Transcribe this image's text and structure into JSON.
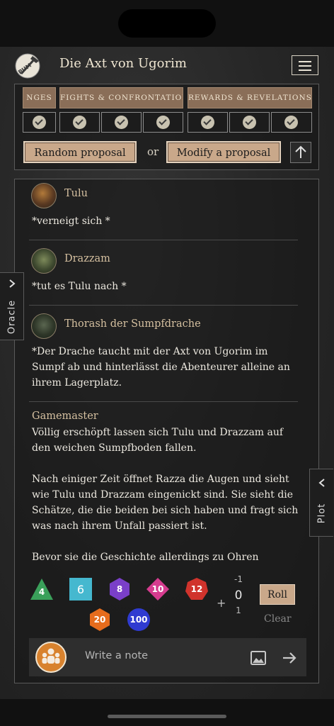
{
  "header": {
    "title": "Die Axt von Ugorim",
    "logo_text": "PUM"
  },
  "oracle": {
    "categories": [
      "NGES",
      "FIGHTS & CONFRONTATION",
      "REWARDS & REVELATIONS"
    ],
    "random_label": "Random proposal",
    "or_label": "or",
    "modify_label": "Modify a proposal"
  },
  "messages": [
    {
      "name": "Tulu",
      "text": "*verneigt sich *"
    },
    {
      "name": "Drazzam",
      "text": "*tut es Tulu nach *"
    },
    {
      "name": "Thorash der Sumpfdrache",
      "text": "*Der Drache taucht mit der Axt von Ugorim im Sumpf ab und hinterlässt die Abenteurer alleine an ihrem Lagerplatz."
    }
  ],
  "gamemaster": {
    "name": "Gamemaster",
    "paragraphs": [
      "Völlig erschöpft lassen sich Tulu und Drazzam auf den weichen Sumpfboden fallen.",
      "Nach einiger Zeit öffnet Razza die Augen und sieht wie Tulu und Drazzam eingenickt sind. Sie sieht die Schätze, die die beiden bei sich haben und fragt sich was nach ihrem Unfall passiert ist.",
      "Bevor sie die Geschichte allerdings zu Ohren"
    ]
  },
  "dice": [
    {
      "label": "4",
      "color": "#3aa05a"
    },
    {
      "label": "6",
      "color": "#45b8cf"
    },
    {
      "label": "8",
      "color": "#7a3fc9"
    },
    {
      "label": "10",
      "color": "#d63c8f"
    },
    {
      "label": "12",
      "color": "#d0332c"
    },
    {
      "label": "20",
      "color": "#e66c1d"
    },
    {
      "label": "100",
      "color": "#2f3bd0"
    }
  ],
  "modifier": {
    "plus": "+",
    "minus_label": "-1",
    "value": "0",
    "plus_label": "1"
  },
  "roll_label": "Roll",
  "clear_label": "Clear",
  "composer": {
    "placeholder": "Write a note"
  },
  "side_tabs": {
    "oracle": "Oracle",
    "plot": "Plot"
  }
}
